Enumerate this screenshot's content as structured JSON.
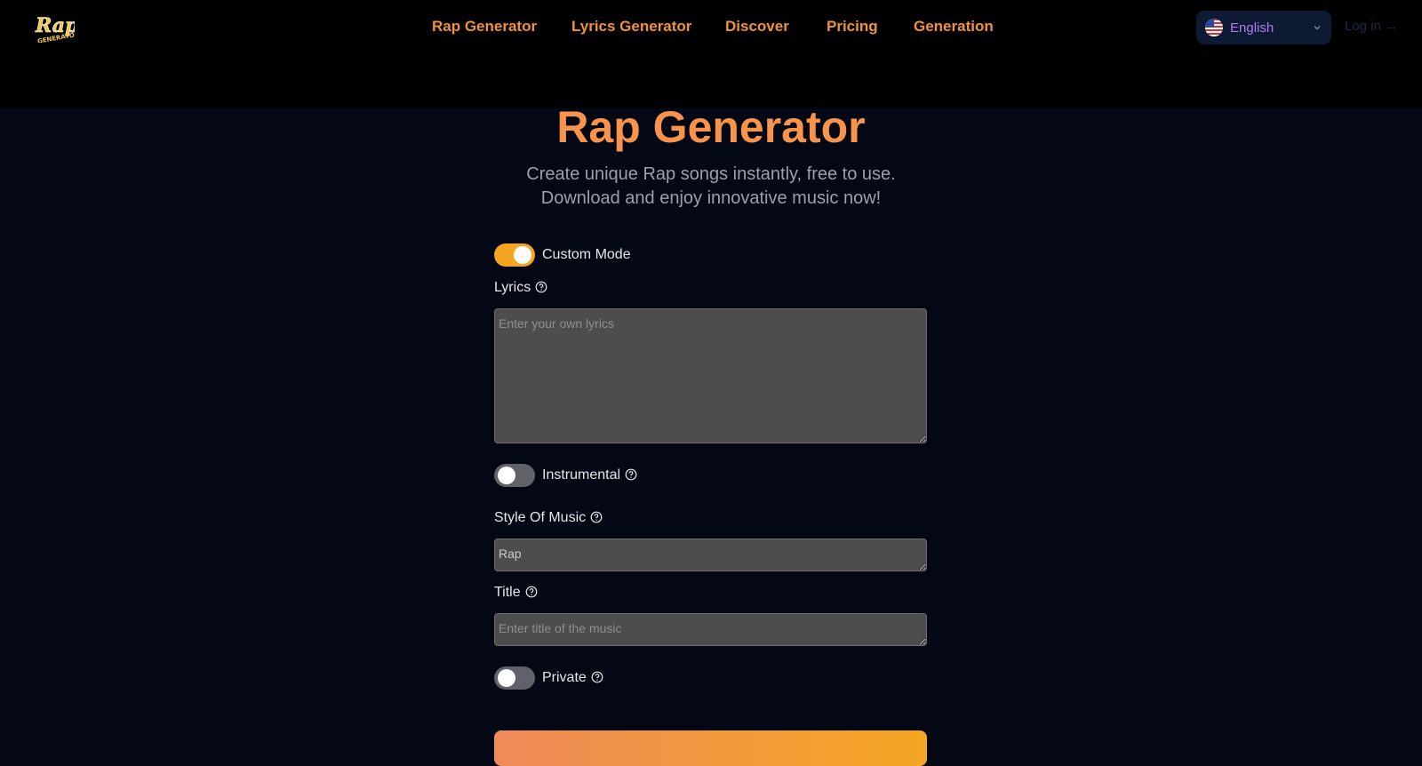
{
  "nav": {
    "logo_alt": "Rap Generator",
    "links": [
      "Rap Generator",
      "Lyrics Generator",
      "Discover",
      "Pricing",
      "Generation"
    ],
    "language": "English",
    "login": "Log in →"
  },
  "hero": {
    "title": "Rap Generator",
    "subtitle_line1": "Create unique Rap songs instantly, free to use.",
    "subtitle_line2": "Download and enjoy innovative music now!"
  },
  "form": {
    "custom_mode": {
      "label": "Custom Mode",
      "on": true
    },
    "lyrics": {
      "label": "Lyrics",
      "placeholder": "Enter your own lyrics"
    },
    "instrumental": {
      "label": "Instrumental",
      "on": false
    },
    "style": {
      "label": "Style Of Music",
      "value": "Rap"
    },
    "title": {
      "label": "Title",
      "placeholder": "Enter title of the music"
    },
    "private": {
      "label": "Private",
      "on": false
    }
  },
  "colors": {
    "accent": "#f7934a",
    "toggle_on": "#f4a623",
    "background": "#040714"
  }
}
